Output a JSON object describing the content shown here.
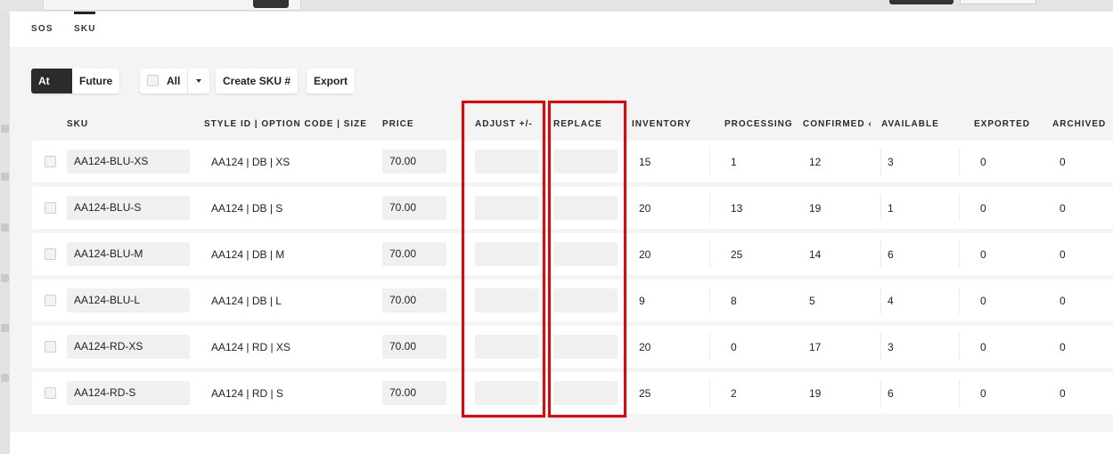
{
  "tabs": [
    {
      "label": "SOS",
      "active": false
    },
    {
      "label": "SKU",
      "active": true
    }
  ],
  "toolbar": {
    "at_once": "At Once",
    "future": "Future",
    "all": "All",
    "create_sku": "Create SKU #",
    "export": "Export"
  },
  "columns": {
    "sku": "SKU",
    "style": "STYLE ID | OPTION CODE | SIZE",
    "price": "PRICE",
    "adjust": "ADJUST +/-",
    "replace": "REPLACE",
    "inventory": "INVENTORY",
    "processing": "PROCESSING",
    "confirmed": "CONFIRMED ‹",
    "available": "AVAILABLE",
    "exported": "EXPORTED",
    "archived": "ARCHIVED"
  },
  "rows": [
    {
      "sku": "AA124-BLU-XS",
      "style": "AA124 | DB | XS",
      "price": "70.00",
      "adjust": "",
      "replace": "",
      "inventory": "15",
      "processing": "1",
      "confirmed": "12",
      "available": "3",
      "exported": "0",
      "archived": "0"
    },
    {
      "sku": "AA124-BLU-S",
      "style": "AA124 | DB | S",
      "price": "70.00",
      "adjust": "",
      "replace": "",
      "inventory": "20",
      "processing": "13",
      "confirmed": "19",
      "available": "1",
      "exported": "0",
      "archived": "0"
    },
    {
      "sku": "AA124-BLU-M",
      "style": "AA124 | DB | M",
      "price": "70.00",
      "adjust": "",
      "replace": "",
      "inventory": "20",
      "processing": "25",
      "confirmed": "14",
      "available": "6",
      "exported": "0",
      "archived": "0"
    },
    {
      "sku": "AA124-BLU-L",
      "style": "AA124 | DB | L",
      "price": "70.00",
      "adjust": "",
      "replace": "",
      "inventory": "9",
      "processing": "8",
      "confirmed": "5",
      "available": "4",
      "exported": "0",
      "archived": "0"
    },
    {
      "sku": "AA124-RD-XS",
      "style": "AA124 | RD | XS",
      "price": "70.00",
      "adjust": "",
      "replace": "",
      "inventory": "20",
      "processing": "0",
      "confirmed": "17",
      "available": "3",
      "exported": "0",
      "archived": "0"
    },
    {
      "sku": "AA124-RD-S",
      "style": "AA124 | RD | S",
      "price": "70.00",
      "adjust": "",
      "replace": "",
      "inventory": "25",
      "processing": "2",
      "confirmed": "19",
      "available": "6",
      "exported": "0",
      "archived": "0"
    }
  ],
  "colors": {
    "highlight": "#f00000",
    "active_button": "#2b2b2b",
    "panel_background": "#f4f4f5",
    "input_background": "#f0f0f1"
  },
  "icons": {
    "dropdown": "chevron-down-icon"
  }
}
